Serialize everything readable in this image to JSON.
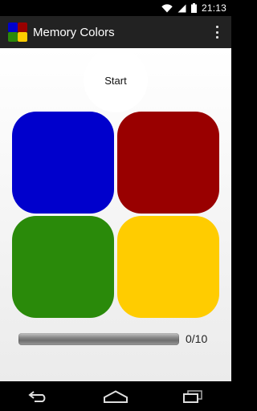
{
  "status_bar": {
    "time": "21:13",
    "icons": [
      "wifi-icon",
      "signal-icon",
      "battery-icon"
    ]
  },
  "action_bar": {
    "title": "Memory Colors",
    "app_icon": "app-logo-icon",
    "menu_icon": "overflow-menu-icon"
  },
  "game": {
    "start_label": "Start",
    "tiles": [
      {
        "name": "blue",
        "color": "#0000cc"
      },
      {
        "name": "red",
        "color": "#990000"
      },
      {
        "name": "green",
        "color": "#2a8a0a"
      },
      {
        "name": "yellow",
        "color": "#ffcc00"
      }
    ],
    "progress": {
      "current": 0,
      "total": 10,
      "text": "0/10",
      "fraction": 0
    }
  },
  "nav_bar": {
    "icons": [
      "back-icon",
      "home-icon",
      "recents-icon"
    ]
  }
}
